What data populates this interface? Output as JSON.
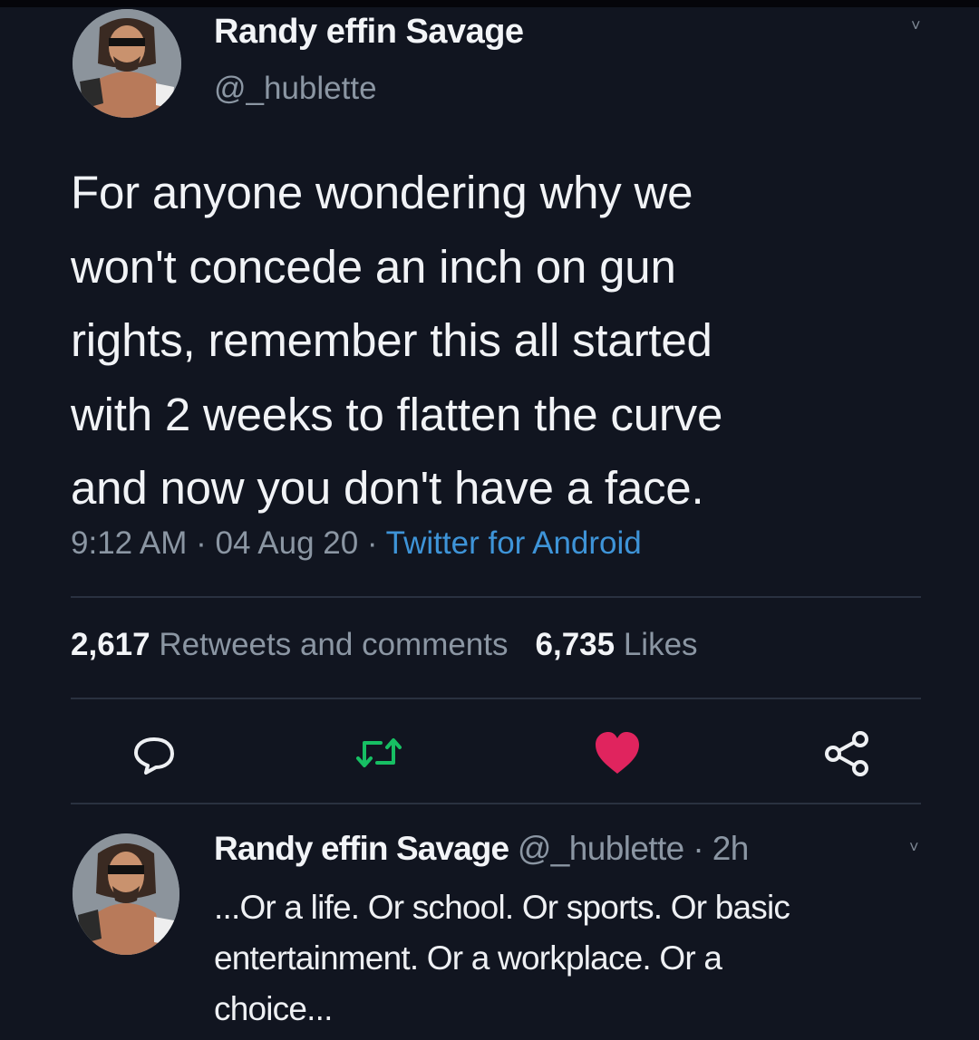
{
  "tweet": {
    "author_name": "Randy effin Savage",
    "author_handle": "@_hublette",
    "text": "For anyone wondering why we\nwon't concede an inch on gun\nrights, remember this all started\nwith 2 weeks to flatten the curve\nand now you don't have a face.",
    "time": "9:12 AM",
    "separator": " · ",
    "date": "04 Aug 20",
    "source": "Twitter for Android",
    "retweets_count": "2,617",
    "retweets_label": "Retweets and comments",
    "likes_count": "6,735",
    "likes_label": "Likes",
    "liked": true
  },
  "actions": {
    "reply_icon": "reply-bubble-icon",
    "retweet_icon": "retweet-icon",
    "like_icon": "heart-icon",
    "share_icon": "share-icon"
  },
  "reply": {
    "author_name": "Randy effin Savage",
    "author_handle": "@_hublette",
    "separator": " · ",
    "age": "2h",
    "text": "...Or a life. Or school. Or sports. Or basic\nentertainment. Or a workplace. Or a\nchoice..."
  },
  "colors": {
    "background": "#111520",
    "text": "#f1f3f6",
    "muted": "#8b96a3",
    "link": "#3e94d8",
    "retweet_green": "#17bf63",
    "like_pink": "#e0245e",
    "divider": "#2a3140"
  }
}
